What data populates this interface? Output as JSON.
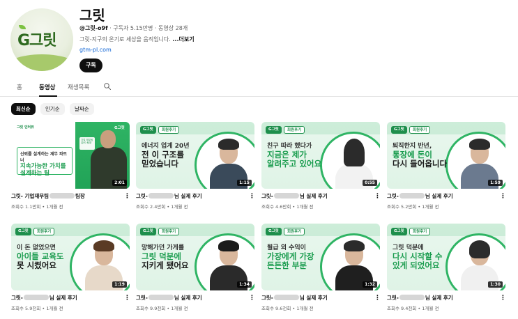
{
  "channel": {
    "name": "그릿",
    "avatar_logo": "G그릿",
    "handle": "@그릿-o9f",
    "subscribers": "구독자 5.15만명",
    "videos_count": "동영상 28개",
    "separator": "‧",
    "description": "그릿-지구의 온기로 세상을 움직입니다. ",
    "more_label": "...더보기",
    "link": "gtm-pl.com",
    "subscribe_label": "구독"
  },
  "tabs": [
    {
      "label": "홈"
    },
    {
      "label": "동영상"
    },
    {
      "label": "재생목록"
    }
  ],
  "search_icon": "search-icon",
  "chips": [
    {
      "label": "최신순"
    },
    {
      "label": "인기순"
    },
    {
      "label": "날짜순"
    }
  ],
  "videos": [
    {
      "thumb_mini": "그릿 인터뷰",
      "thumb_corner": "G그릿",
      "thumb_box_line1": "신뢰를 설계하는 재무 파트너",
      "thumb_box_line2": "지속가능한 가치를 설계하는 팀",
      "thumb_slide": "기업 재무팀 김00 팀장",
      "duration": "2:01",
      "title_prefix": "그릿- 기업재무팀",
      "title_suffix": "팀장",
      "views": "조회수 1.1만회",
      "age": "1개월 전"
    },
    {
      "badge": "G그릿",
      "badge2": "회원후기",
      "l1": "에너지 업계 20년",
      "l2": "전 이 구조를",
      "l3": "믿었습니다",
      "duration": "1:15",
      "title_prefix": "그릿-",
      "title_suffix": "님 실제 후기",
      "views": "조회수 2.4만회",
      "age": "1개월 전"
    },
    {
      "badge": "G그릿",
      "badge2": "회원후기",
      "l1": "친구 따라 했다가",
      "l2": "지금은 제가",
      "l3": "알려주고 있어요",
      "duration": "0:55",
      "title_prefix": "그릿-",
      "title_suffix": "님 실제 후기",
      "views": "조회수 4.6만회",
      "age": "1개월 전"
    },
    {
      "badge": "G그릿",
      "badge2": "회원후기",
      "l1": "퇴직한지 반년,",
      "l2": "통장에 돈이",
      "l3": "다시 들어옵니다",
      "duration": "1:59",
      "title_prefix": "그릿-",
      "title_suffix": "님 실제 후기",
      "views": "조회수 5.2만회",
      "age": "1개월 전"
    },
    {
      "badge": "G그릿",
      "badge2": "회원후기",
      "l1": "이 돈 없었으면",
      "l2": "아이들 교육도",
      "l3": "못 시켰어요",
      "duration": "1:19",
      "title_prefix": "그릿-",
      "title_suffix": "님 실제 후기",
      "views": "조회수 5.9천회",
      "age": "1개월 전"
    },
    {
      "badge": "G그릿",
      "badge2": "회원후기",
      "l1": "망해가던 가게를",
      "l2": "그릿 덕분에",
      "l3": "지키게 됐어요",
      "duration": "1:34",
      "title_prefix": "그릿-",
      "title_suffix": "님 실제 후기",
      "views": "조회수 9.9천회",
      "age": "1개월 전"
    },
    {
      "badge": "G그릿",
      "badge2": "회원후기",
      "l1": "월급 외 수익이",
      "l2": "가장에게 가장",
      "l3": "든든한 부분",
      "duration": "1:32",
      "title_prefix": "그릿-",
      "title_suffix": "님 실제 후기",
      "views": "조회수 9.6천회",
      "age": "1개월 전"
    },
    {
      "badge": "G그릿",
      "badge2": "회원후기",
      "l1": "그릿 덕분에",
      "l2": "다시 시작할 수",
      "l3": "있게 되었어요",
      "duration": "1:30",
      "title_prefix": "그릿-",
      "title_suffix": "님 실제 후기",
      "views": "조회수 9.4천회",
      "age": "1개월 전"
    }
  ],
  "kebab_icon": "more-vert-icon",
  "colors": {
    "brand_green": "#2fb464",
    "link_blue": "#065fd4"
  }
}
